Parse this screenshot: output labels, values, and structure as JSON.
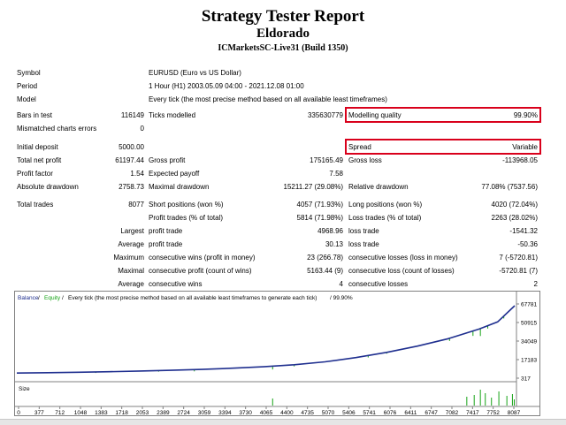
{
  "report": {
    "title": "Strategy Tester Report",
    "expert": "Eldorado",
    "server": "ICMarketsSC-Live31 (Build 1350)"
  },
  "settings": {
    "symbol_label": "Symbol",
    "symbol_value": "EURUSD (Euro vs US Dollar)",
    "period_label": "Period",
    "period_value": "1 Hour (H1) 2003.05.09 04:00 - 2021.12.08 01:00",
    "model_label": "Model",
    "model_value": "Every tick (the most precise method based on all available least timeframes)"
  },
  "stats": {
    "bars_label": "Bars in test",
    "bars_value": "116149",
    "ticks_label": "Ticks modelled",
    "ticks_value": "335630779",
    "quality_label": "Modelling quality",
    "quality_value": "99.90%",
    "mismatch_label": "Mismatched charts errors",
    "mismatch_value": "0",
    "deposit_label": "Initial deposit",
    "deposit_value": "5000.00",
    "spread_label": "Spread",
    "spread_value": "Variable",
    "netprofit_label": "Total net profit",
    "netprofit_value": "61197.44",
    "grossprofit_label": "Gross profit",
    "grossprofit_value": "175165.49",
    "grossloss_label": "Gross loss",
    "grossloss_value": "-113968.05",
    "pf_label": "Profit factor",
    "pf_value": "1.54",
    "payoff_label": "Expected payoff",
    "payoff_value": "7.58",
    "absdd_label": "Absolute drawdown",
    "absdd_value": "2758.73",
    "maxdd_label": "Maximal drawdown",
    "maxdd_value": "15211.27 (29.08%)",
    "reldd_label": "Relative drawdown",
    "reldd_value": "77.08% (7537.56)",
    "trades_label": "Total trades",
    "trades_value": "8077",
    "short_label": "Short positions (won %)",
    "short_value": "4057 (71.93%)",
    "long_label": "Long positions (won %)",
    "long_value": "4020 (72.04%)",
    "pt_label": "Profit trades (% of total)",
    "pt_value": "5814 (71.98%)",
    "lt_label": "Loss trades (% of total)",
    "lt_value": "2263 (28.02%)",
    "largest_label": "Largest",
    "largest_pt_label": "profit trade",
    "largest_pt_value": "4968.96",
    "largest_lt_label": "loss trade",
    "largest_lt_value": "-1541.32",
    "average_label": "Average",
    "average_pt_label": "profit trade",
    "average_pt_value": "30.13",
    "average_lt_label": "loss trade",
    "average_lt_value": "-50.36",
    "maximum_label": "Maximum",
    "max_cw_label": "consecutive wins (profit in money)",
    "max_cw_value": "23 (266.78)",
    "max_cl_label": "consecutive losses (loss in money)",
    "max_cl_value": "7 (-5720.81)",
    "maximal_label": "Maximal",
    "maximal_cp_label": "consecutive profit (count of wins)",
    "maximal_cp_value": "5163.44 (9)",
    "maximal_cl_label": "consecutive loss (count of losses)",
    "maximal_cl_value": "-5720.81 (7)",
    "average2_label": "Average",
    "avg_cw_label": "consecutive wins",
    "avg_cw_value": "4",
    "avg_cl_label": "consecutive losses",
    "avg_cl_value": "2"
  },
  "chart_data": {
    "type": "line",
    "legend": [
      "Balance",
      "Equity"
    ],
    "legend_sep": " / ",
    "caption": "Every tick (the most precise method based on all available least timeframes to generate each tick)",
    "caption_suffix": " / 99.90%",
    "x_ticks": [
      "0",
      "377",
      "712",
      "1048",
      "1383",
      "1718",
      "2053",
      "2389",
      "2724",
      "3059",
      "3394",
      "3730",
      "4065",
      "4400",
      "4735",
      "5070",
      "5406",
      "5741",
      "6076",
      "6411",
      "6747",
      "7082",
      "7417",
      "7752",
      "8087"
    ],
    "y_ticks": [
      "67781",
      "50915",
      "34049",
      "17183",
      "317"
    ],
    "ylim": [
      317,
      67781
    ],
    "xlim": [
      0,
      8077
    ],
    "size_label": "Size",
    "balance": [
      [
        0,
        5000
      ],
      [
        500,
        5300
      ],
      [
        1000,
        5700
      ],
      [
        1500,
        6200
      ],
      [
        2000,
        6800
      ],
      [
        2500,
        7500
      ],
      [
        3000,
        8300
      ],
      [
        3500,
        9400
      ],
      [
        4000,
        10700
      ],
      [
        4500,
        12500
      ],
      [
        5000,
        15200
      ],
      [
        5500,
        19000
      ],
      [
        6000,
        23800
      ],
      [
        6500,
        29500
      ],
      [
        7000,
        36200
      ],
      [
        7500,
        45000
      ],
      [
        7800,
        51500
      ],
      [
        8077,
        66200
      ]
    ],
    "colors": {
      "balance": "#1f2f8f",
      "equity": "#16a316",
      "size": "#16a316"
    }
  }
}
